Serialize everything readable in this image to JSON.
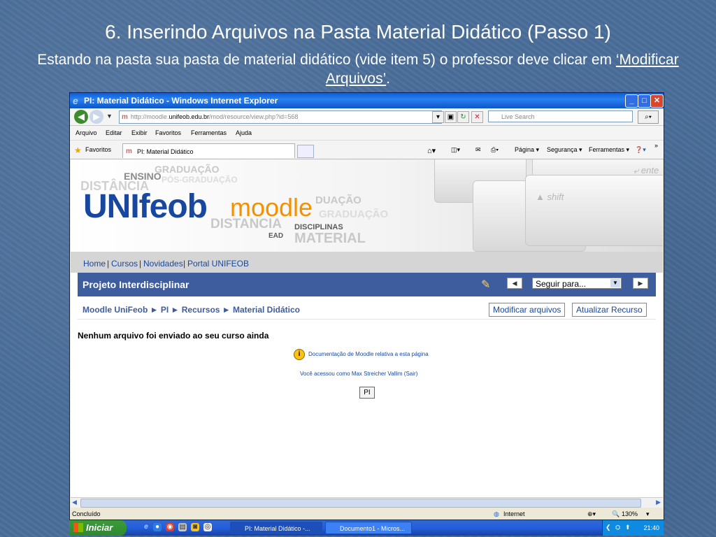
{
  "slide": {
    "title": "6. Inserindo Arquivos na Pasta Material Didático (Passo 1)",
    "subtitle_before": "Estando na pasta sua pasta de material didático (vide item 5) o professor deve clicar em ",
    "subtitle_link": "‘Modificar Arquivos’",
    "subtitle_after": "."
  },
  "browser": {
    "window_title": "PI: Material Didático - Windows Internet Explorer",
    "address_prefix": "http://moodle.",
    "address_domain": "unifeob.edu.br",
    "address_suffix": "/mod/resource/view.php?id=568",
    "search_placeholder": "Live Search",
    "menu": [
      "Arquivo",
      "Editar",
      "Exibir",
      "Favoritos",
      "Ferramentas",
      "Ajuda"
    ],
    "favorites_label": "Favoritos",
    "tab_title": "PI: Material Didático",
    "toolbar_right": [
      "Página ▾",
      "Segurança ▾",
      "Ferramentas ▾"
    ],
    "status_left": "Concluído",
    "status_zone": "Internet",
    "zoom": "130%"
  },
  "page": {
    "logo_uni": "UNIfeob",
    "logo_moodle": "moodle",
    "banner_words": [
      "ENSINO",
      "GRADUAÇÃO",
      "DISTÂNCIA",
      "PÓS-GRADUAÇÃO",
      "DUAÇÃO",
      "GRADUAÇÃO",
      "DISTANCIA",
      "DISCIPLINAS",
      "EAD",
      "MATERIAL"
    ],
    "top_nav": [
      "Home",
      "Cursos",
      "Novidades",
      "Portal UNIFEOB"
    ],
    "course_title": "Projeto Interdisciplinar",
    "jump_label": "Seguir para...",
    "breadcrumb": "Moodle UniFeob ► PI ► Recursos ► Material Didático",
    "btn_modify": "Modificar arquivos",
    "btn_update": "Atualizar Recurso",
    "empty_message": "Nenhum arquivo foi enviado ao seu curso ainda",
    "doc_link": "Documentação de Moodle relativa a esta página",
    "login_info": "Você acessou como Max Streicher Vallim (Sair)",
    "course_shortname": "PI"
  },
  "taskbar": {
    "start_label": "Iniciar",
    "tasks": [
      "PI: Material Didático -...",
      "Documento1 - Micros..."
    ],
    "clock": "21:40"
  }
}
